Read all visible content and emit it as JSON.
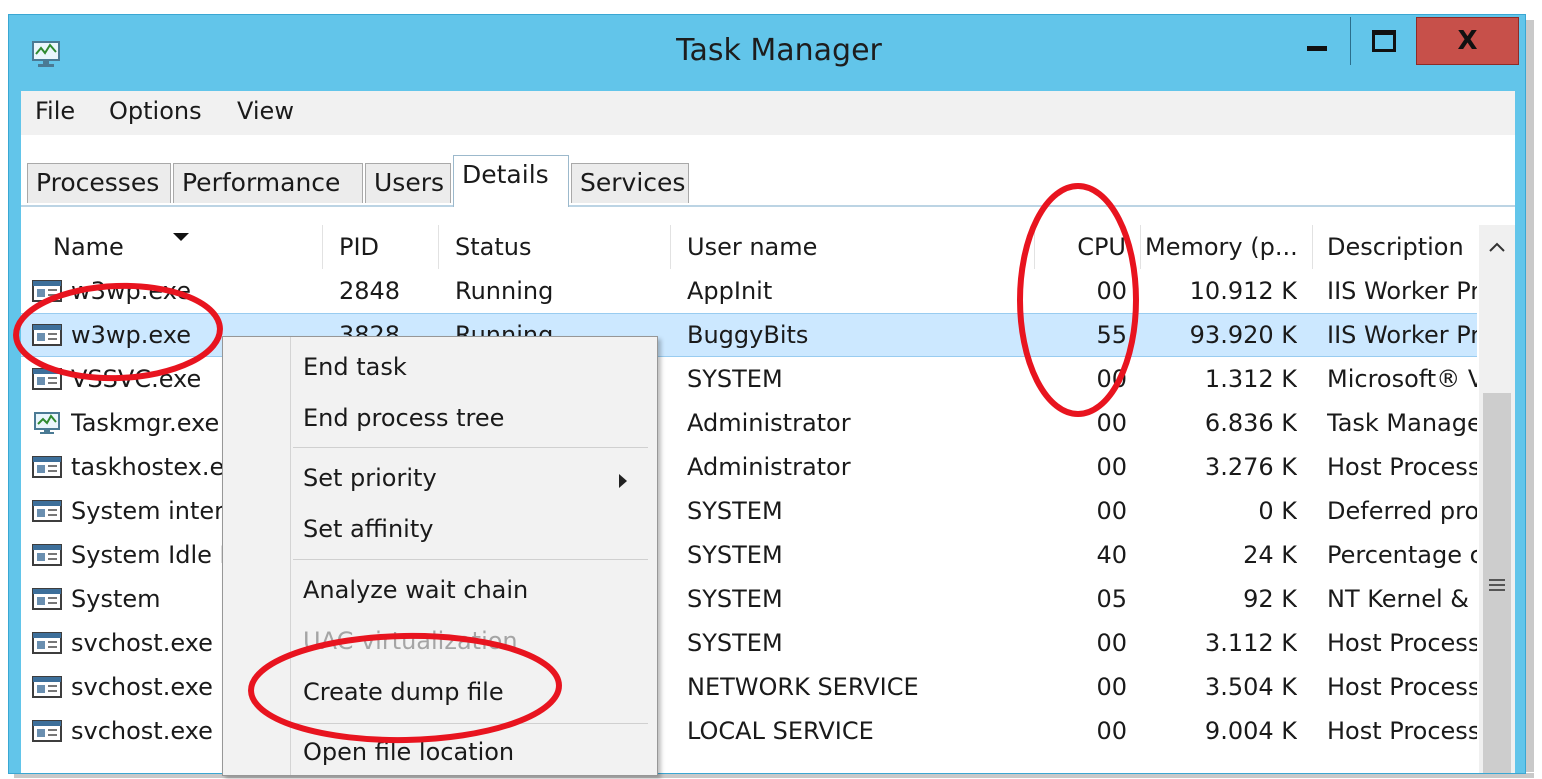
{
  "window": {
    "title": "Task Manager",
    "icon": "task-manager-icon"
  },
  "title_buttons": {
    "minimize": "minimize-icon",
    "maximize": "maximize-icon",
    "close_label": "X"
  },
  "menu": [
    "File",
    "Options",
    "View"
  ],
  "tabs": [
    "Processes",
    "Performance",
    "Users",
    "Details",
    "Services"
  ],
  "active_tab": "Details",
  "columns": [
    "Name",
    "PID",
    "Status",
    "User name",
    "CPU",
    "Memory (p...",
    "Description"
  ],
  "sort": {
    "column": "Name",
    "direction": "descending"
  },
  "rows": [
    {
      "name": "w3wp.exe",
      "pid": "2848",
      "status": "Running",
      "user": "AppInit",
      "cpu": "00",
      "memory": "10.912 K",
      "description": "IIS Worker Pr",
      "icon": "app-window-icon"
    },
    {
      "name": "w3wp.exe",
      "pid": "3828",
      "status": "Running",
      "user": "BuggyBits",
      "cpu": "55",
      "memory": "93.920 K",
      "description": "IIS Worker Pr",
      "icon": "app-window-icon",
      "selected": true
    },
    {
      "name": "VSSVC.exe",
      "pid": "",
      "status": "",
      "user": "SYSTEM",
      "cpu": "00",
      "memory": "1.312 K",
      "description": "Microsoft® V",
      "icon": "app-window-icon"
    },
    {
      "name": "Taskmgr.exe",
      "pid": "",
      "status": "",
      "user": "Administrator",
      "cpu": "00",
      "memory": "6.836 K",
      "description": "Task Manage",
      "icon": "task-manager-icon"
    },
    {
      "name": "taskhostex.exe",
      "pid": "",
      "status": "",
      "user": "Administrator",
      "cpu": "00",
      "memory": "3.276 K",
      "description": "Host Process",
      "icon": "app-window-icon"
    },
    {
      "name": "System interrupts",
      "pid": "",
      "status": "",
      "user": "SYSTEM",
      "cpu": "00",
      "memory": "0 K",
      "description": "Deferred proc",
      "icon": "app-window-icon"
    },
    {
      "name": "System Idle Process",
      "pid": "",
      "status": "",
      "user": "SYSTEM",
      "cpu": "40",
      "memory": "24 K",
      "description": "Percentage c",
      "icon": "app-window-icon"
    },
    {
      "name": "System",
      "pid": "",
      "status": "",
      "user": "SYSTEM",
      "cpu": "05",
      "memory": "92 K",
      "description": "NT Kernel &",
      "icon": "app-window-icon"
    },
    {
      "name": "svchost.exe",
      "pid": "",
      "status": "",
      "user": "SYSTEM",
      "cpu": "00",
      "memory": "3.112 K",
      "description": "Host Process",
      "icon": "app-window-icon"
    },
    {
      "name": "svchost.exe",
      "pid": "",
      "status": "",
      "user": "NETWORK SERVICE",
      "cpu": "00",
      "memory": "3.504 K",
      "description": "Host Process",
      "icon": "app-window-icon"
    },
    {
      "name": "svchost.exe",
      "pid": "",
      "status": "",
      "user": "LOCAL SERVICE",
      "cpu": "00",
      "memory": "9.004 K",
      "description": "Host Process",
      "icon": "app-window-icon"
    }
  ],
  "context_menu": [
    {
      "label": "End task",
      "enabled": true
    },
    {
      "label": "End process tree",
      "enabled": true
    },
    {
      "separator": true
    },
    {
      "label": "Set priority",
      "enabled": true,
      "submenu": true
    },
    {
      "label": "Set affinity",
      "enabled": true
    },
    {
      "separator": true
    },
    {
      "label": "Analyze wait chain",
      "enabled": true
    },
    {
      "label": "UAC virtualization",
      "enabled": false
    },
    {
      "label": "Create dump file",
      "enabled": true
    },
    {
      "separator": true
    },
    {
      "label": "Open file location",
      "enabled": true
    }
  ],
  "annotations": {
    "color": "#e8141f",
    "style": "hand-drawn ellipses",
    "targets": [
      "w3wp.exe (BuggyBits) name cell",
      "CPU column",
      "Create dump file menu item"
    ]
  },
  "colors": {
    "titlebar": "#62c5ea",
    "close_button": "#c7504a",
    "selection": "#cce8ff",
    "menu_background": "#f2f2f2",
    "disabled_text": "#a5a5a5"
  }
}
